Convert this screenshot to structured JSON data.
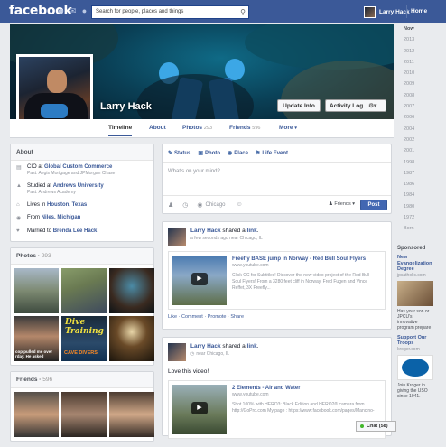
{
  "topbar": {
    "logo": "facebook",
    "search_placeholder": "Search for people, places and things",
    "user_name": "Larry Hack",
    "home_label": "Home"
  },
  "profile": {
    "name": "Larry Hack",
    "update_info": "Update Info",
    "activity_log": "Activity Log"
  },
  "nav": {
    "tabs": [
      {
        "label": "Timeline",
        "count": ""
      },
      {
        "label": "About",
        "count": ""
      },
      {
        "label": "Photos",
        "count": "293"
      },
      {
        "label": "Friends",
        "count": "596"
      },
      {
        "label": "More",
        "count": ""
      }
    ]
  },
  "about": {
    "title": "About",
    "items": [
      {
        "pre": "CIO at ",
        "link": "Global Custom Commerce",
        "sub": "Past: Aegis Mortgage and JPMorgan Chase"
      },
      {
        "pre": "Studied at ",
        "link": "Andrews University",
        "sub": "Past: Andrews Academy"
      },
      {
        "pre": "Lives in ",
        "link": "Houston, Texas",
        "sub": ""
      },
      {
        "pre": "From ",
        "link": "Niles, Michigan",
        "sub": ""
      },
      {
        "pre": "Married to ",
        "link": "Brenda Lee Hack",
        "sub": ""
      }
    ]
  },
  "photos": {
    "title": "Photos",
    "count": "293",
    "captions": [
      "",
      "",
      "",
      "cop pulled me over rday. He asked",
      "Dive Training",
      ""
    ],
    "sub_caption": "CAVE DIVERS"
  },
  "friends": {
    "title": "Friends",
    "count": "596"
  },
  "composer": {
    "tabs": [
      "Status",
      "Photo",
      "Place",
      "Life Event"
    ],
    "placeholder": "What's on your mind?",
    "location": "Chicago",
    "audience": "Friends",
    "post_label": "Post"
  },
  "stories": [
    {
      "name": "Larry Hack",
      "verb": " shared a ",
      "object": "link",
      "meta": "a few seconds ago near Chicago, IL",
      "text": "",
      "link_title": "Freefly BASE jump in Norway - Red Bull Soul Flyers",
      "link_domain": "www.youtube.com",
      "link_desc": "Click CC for Subtitles! Discover the new video project of the Red Bull Soul Flyers! From a 3280 feet cliff in Norway, Fred Fugen and Vince Reffet, 3X Freefly...",
      "actions": "Like · Comment · Promote · Share"
    },
    {
      "name": "Larry Hack",
      "verb": " shared a ",
      "object": "link",
      "meta": "near Chicago, IL",
      "text": "Love this video!",
      "link_title": "2 Elements - Air and Water",
      "link_domain": "www.youtube.com",
      "link_desc": "Shot 100% with HERO3: Black Edition and HERO2® camera from http://GoPro.com My page : https://www.facebook.com/pages/Mancino-",
      "actions": ""
    }
  ],
  "timeline": {
    "years": [
      "Now",
      "2013",
      "2012",
      "2011",
      "2010",
      "2009",
      "2008",
      "2007",
      "2006",
      "2004",
      "2002",
      "2001",
      "1998",
      "1987",
      "1986",
      "1984",
      "1980",
      "1972",
      "Born"
    ]
  },
  "sponsored": {
    "title": "Sponsored",
    "ads": [
      {
        "title": "New Evangelization Degree",
        "domain": "jpcatholic.com",
        "text": "Has your son or JPCU's innovative program prepare"
      },
      {
        "title": "Support Our Troops",
        "domain": "kroger.com",
        "text": "Join Kroger in giving the USO since 1941."
      }
    ]
  },
  "chat": {
    "label": "Chat (58)"
  }
}
